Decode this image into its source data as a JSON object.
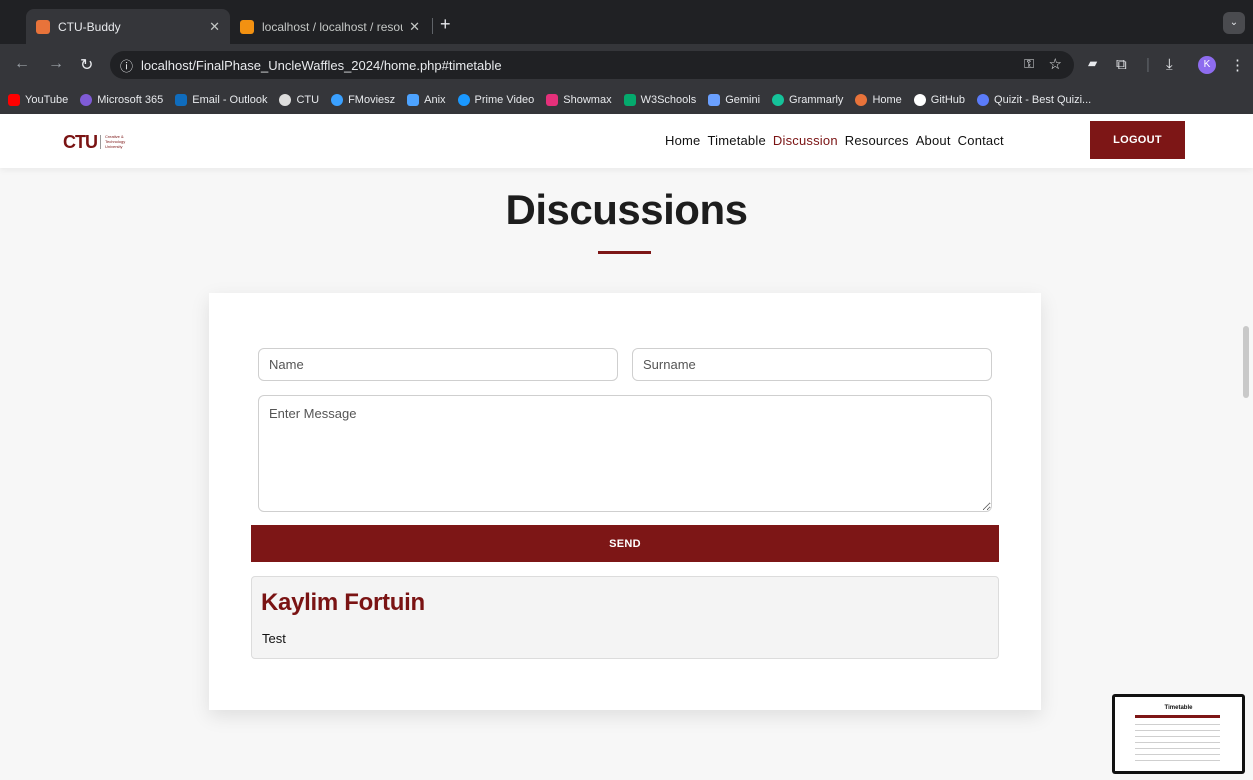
{
  "browser": {
    "tabs": [
      {
        "title": "CTU-Buddy",
        "active": true,
        "favicon_color": "#e8733a"
      },
      {
        "title": "localhost / localhost / resourc",
        "active": false,
        "favicon_color": "#f29111"
      }
    ],
    "url": "localhost/FinalPhase_UncleWaffles_2024/home.php#timetable",
    "profile_initial": "K",
    "bookmarks": [
      {
        "label": "YouTube",
        "color": "#ff0000"
      },
      {
        "label": "Microsoft 365",
        "color": "#7f5bd6"
      },
      {
        "label": "Email - Outlook",
        "color": "#0f6cbd"
      },
      {
        "label": "CTU",
        "color": "#dddddd"
      },
      {
        "label": "FMoviesz",
        "color": "#3aa0ff"
      },
      {
        "label": "Anix",
        "color": "#4da3ff"
      },
      {
        "label": "Prime Video",
        "color": "#1a98ff"
      },
      {
        "label": "Showmax",
        "color": "#e5307a"
      },
      {
        "label": "W3Schools",
        "color": "#04aa6d"
      },
      {
        "label": "Gemini",
        "color": "#6aa0ff"
      },
      {
        "label": "Grammarly",
        "color": "#15c39a"
      },
      {
        "label": "Home",
        "color": "#e8733a"
      },
      {
        "label": "GitHub",
        "color": "#ffffff"
      },
      {
        "label": "Quizit - Best Quizi...",
        "color": "#5b7cfa"
      }
    ]
  },
  "header": {
    "logo_mark": "CTU",
    "logo_lines": [
      "Creative &",
      "Technology",
      "University"
    ],
    "nav": [
      {
        "label": "Home",
        "active": false
      },
      {
        "label": "Timetable",
        "active": false
      },
      {
        "label": "Discussion",
        "active": true
      },
      {
        "label": "Resources",
        "active": false
      },
      {
        "label": "About",
        "active": false
      },
      {
        "label": "Contact",
        "active": false
      }
    ],
    "logout_label": "LOGOUT"
  },
  "main": {
    "title": "Discussions",
    "form": {
      "name_placeholder": "Name",
      "surname_placeholder": "Surname",
      "message_placeholder": "Enter Message",
      "send_label": "SEND"
    },
    "posts": [
      {
        "author": "Kaylim Fortuin",
        "message": "Test"
      }
    ]
  },
  "thumbnail": {
    "title": "Timetable"
  },
  "colors": {
    "brand": "#7d1616",
    "nav_active": "#7a1313"
  }
}
